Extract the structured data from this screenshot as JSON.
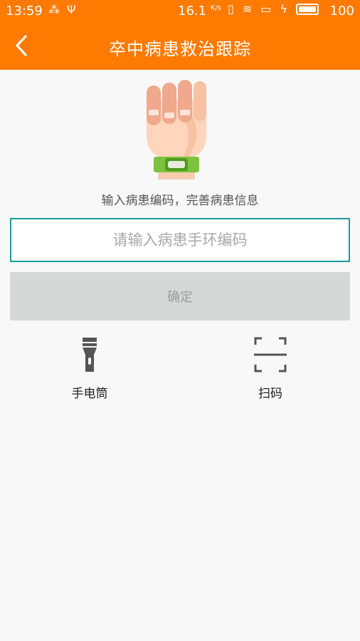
{
  "status_bar": {
    "time": "13:59",
    "net_speed": "16.1",
    "net_speed_unit": "K/s",
    "battery_level": "100"
  },
  "app_bar": {
    "title": "卒中病患救治跟踪"
  },
  "main": {
    "prompt": "输入病患编码，完善病患信息",
    "input_placeholder": "请输入病患手环编码",
    "input_value": "",
    "confirm_label": "确定"
  },
  "tools": {
    "flashlight_label": "手电筒",
    "scan_label": "扫码"
  },
  "colors": {
    "accent": "#ff7a00",
    "input_border": "#1a9a9a",
    "button_disabled": "#d6d8d8"
  },
  "icons": [
    "back-chevron-icon",
    "hand-wristband-illustration",
    "flashlight-icon",
    "scan-frame-icon"
  ]
}
